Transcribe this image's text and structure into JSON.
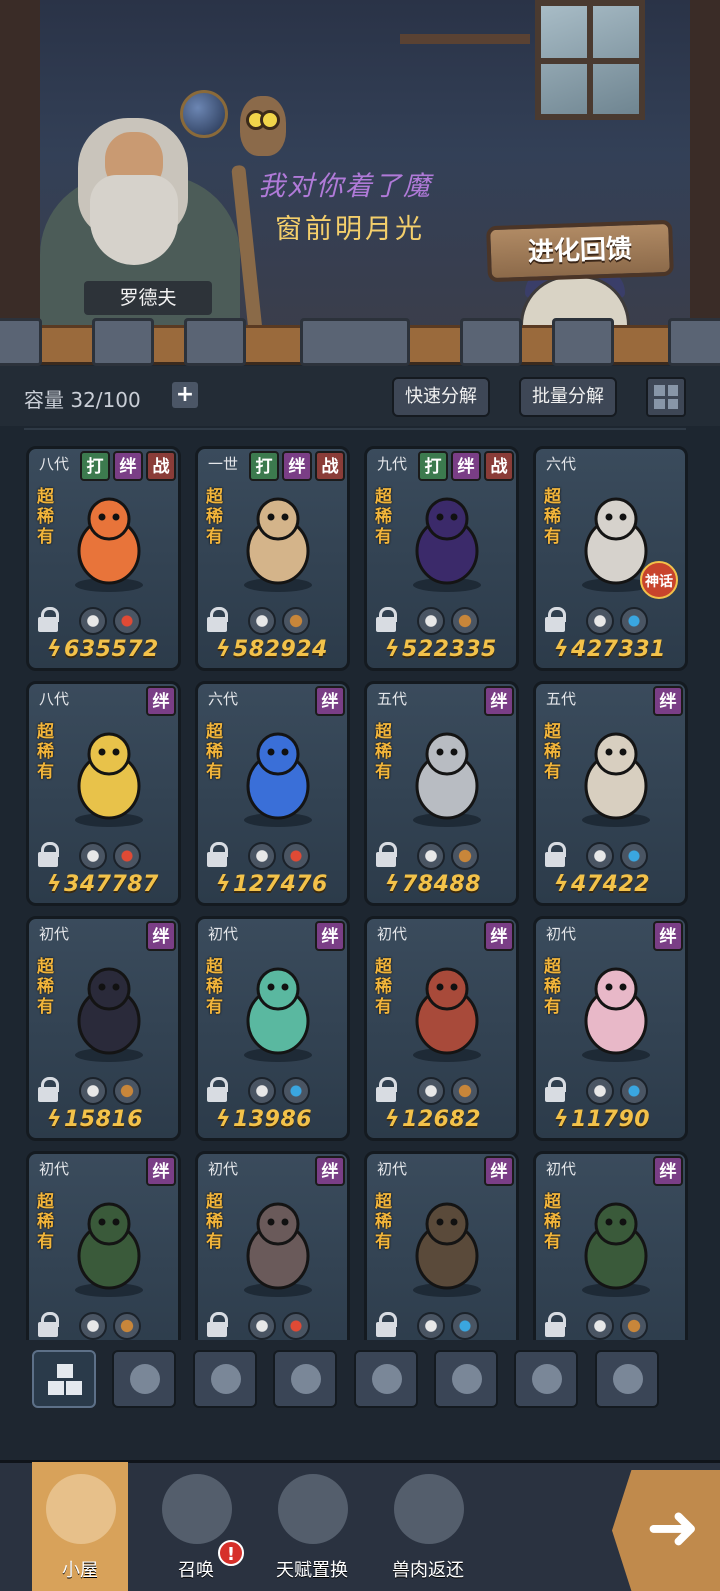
{
  "scene": {
    "npc_name": "罗德夫",
    "speech_line1": "我对你着了魔",
    "speech_line2": "窗前明月光",
    "evolve_button": "进化回馈"
  },
  "toolbar": {
    "capacity_label": "容量 32/100",
    "add_label": "+",
    "quick_decompose": "快速分解",
    "batch_decompose": "批量分解"
  },
  "cards": [
    {
      "gen": "八代",
      "tags": [
        "打",
        "绊",
        "战"
      ],
      "rarity": "超稀有",
      "power": "635572",
      "elements": [
        "c-white",
        "c-red"
      ],
      "color": "#e8743a"
    },
    {
      "gen": "一世",
      "tags": [
        "打",
        "绊",
        "战"
      ],
      "rarity": "超稀有",
      "power": "582924",
      "elements": [
        "c-white",
        "c-brown"
      ],
      "color": "#d4b48a"
    },
    {
      "gen": "九代",
      "tags": [
        "打",
        "绊",
        "战"
      ],
      "rarity": "超稀有",
      "power": "522335",
      "elements": [
        "c-white",
        "c-brown"
      ],
      "color": "#3b2a6a"
    },
    {
      "gen": "六代",
      "tags": [],
      "rarity": "超稀有",
      "power": "427331",
      "elements": [
        "c-white",
        "c-blue"
      ],
      "color": "#d6d2cc",
      "badge": "神话"
    },
    {
      "gen": "八代",
      "tags": [
        "绊"
      ],
      "rarity": "超稀有",
      "power": "347787",
      "elements": [
        "c-white",
        "c-red"
      ],
      "color": "#e8c24a"
    },
    {
      "gen": "六代",
      "tags": [
        "绊"
      ],
      "rarity": "超稀有",
      "power": "127476",
      "elements": [
        "c-white",
        "c-red"
      ],
      "color": "#3a6fd8"
    },
    {
      "gen": "五代",
      "tags": [
        "绊"
      ],
      "rarity": "超稀有",
      "power": "78488",
      "elements": [
        "c-white",
        "c-brown"
      ],
      "color": "#b8bcc2"
    },
    {
      "gen": "五代",
      "tags": [
        "绊"
      ],
      "rarity": "超稀有",
      "power": "47422",
      "elements": [
        "c-white",
        "c-blue"
      ],
      "color": "#d8cfc0"
    },
    {
      "gen": "初代",
      "tags": [
        "绊"
      ],
      "rarity": "超稀有",
      "power": "15816",
      "elements": [
        "c-white",
        "c-brown"
      ],
      "color": "#2a2a3a"
    },
    {
      "gen": "初代",
      "tags": [
        "绊"
      ],
      "rarity": "超稀有",
      "power": "13986",
      "elements": [
        "c-white",
        "c-blue"
      ],
      "color": "#5ab8a0"
    },
    {
      "gen": "初代",
      "tags": [
        "绊"
      ],
      "rarity": "超稀有",
      "power": "12682",
      "elements": [
        "c-white",
        "c-brown"
      ],
      "color": "#a84a3a"
    },
    {
      "gen": "初代",
      "tags": [
        "绊"
      ],
      "rarity": "超稀有",
      "power": "11790",
      "elements": [
        "c-white",
        "c-blue"
      ],
      "color": "#e8b8c8"
    },
    {
      "gen": "初代",
      "tags": [
        "绊"
      ],
      "rarity": "超稀有",
      "power": "",
      "elements": [
        "c-white",
        "c-brown"
      ],
      "color": "#3a5a3a"
    },
    {
      "gen": "初代",
      "tags": [
        "绊"
      ],
      "rarity": "超稀有",
      "power": "",
      "elements": [
        "c-white",
        "c-red"
      ],
      "color": "#6a5a5a"
    },
    {
      "gen": "初代",
      "tags": [
        "绊"
      ],
      "rarity": "超稀有",
      "power": "",
      "elements": [
        "c-white",
        "c-blue"
      ],
      "color": "#5a4a3a"
    },
    {
      "gen": "初代",
      "tags": [
        "绊"
      ],
      "rarity": "超稀有",
      "power": "",
      "elements": [
        "c-white",
        "c-brown"
      ],
      "color": "#3a5a3a"
    }
  ],
  "filters": [
    "all-icon",
    "fist-icon",
    "shield-icon",
    "sprout-icon",
    "alien-icon",
    "tower-icon",
    "crosshair-icon",
    "eye-icon"
  ],
  "nav": [
    {
      "label": "小屋",
      "icon": "hut-icon"
    },
    {
      "label": "召唤",
      "icon": "egg-icon"
    },
    {
      "label": "天赋置换",
      "icon": "fist-icon"
    },
    {
      "label": "兽肉返还",
      "icon": "meat-icon"
    }
  ],
  "alert_mark": "!",
  "next_arrow": "➜"
}
